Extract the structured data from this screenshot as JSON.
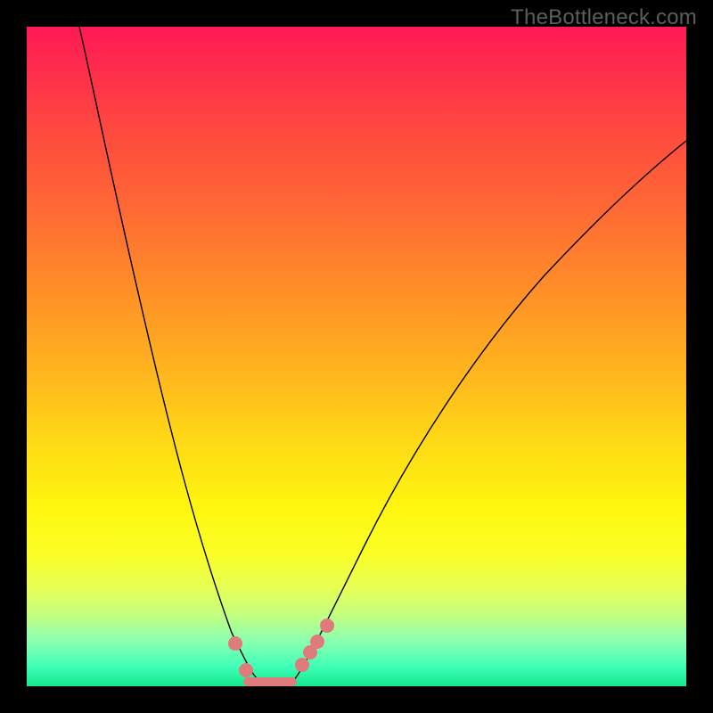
{
  "watermark": "TheBottleneck.com",
  "chart_data": {
    "type": "line",
    "title": "",
    "xlabel": "",
    "ylabel": "",
    "xlim": [
      0,
      100
    ],
    "ylim": [
      0,
      100
    ],
    "series": [
      {
        "name": "left-curve",
        "x": [
          8,
          12,
          16,
          20,
          24,
          28,
          31,
          33,
          35
        ],
        "y": [
          100,
          81,
          63,
          47,
          31,
          17,
          7,
          3,
          1
        ]
      },
      {
        "name": "right-curve",
        "x": [
          40,
          44,
          50,
          58,
          66,
          76,
          88,
          100
        ],
        "y": [
          1,
          6,
          16,
          30,
          44,
          58,
          72,
          83
        ]
      },
      {
        "name": "flat-minimum",
        "x": [
          33,
          40
        ],
        "y": [
          0.5,
          0.5
        ]
      }
    ],
    "markers_left": [
      {
        "x": 31.5,
        "y": 6.5
      },
      {
        "x": 33.2,
        "y": 2.5
      }
    ],
    "markers_right": [
      {
        "x": 41.7,
        "y": 3.2
      },
      {
        "x": 43.0,
        "y": 5.2
      },
      {
        "x": 44.0,
        "y": 6.8
      },
      {
        "x": 45.5,
        "y": 9.2
      }
    ],
    "colors": {
      "gradient_top": "#ff1a56",
      "gradient_mid": "#ffe014",
      "gradient_bottom": "#15e88e",
      "curve": "#000000",
      "dot": "#e07b7c"
    }
  }
}
